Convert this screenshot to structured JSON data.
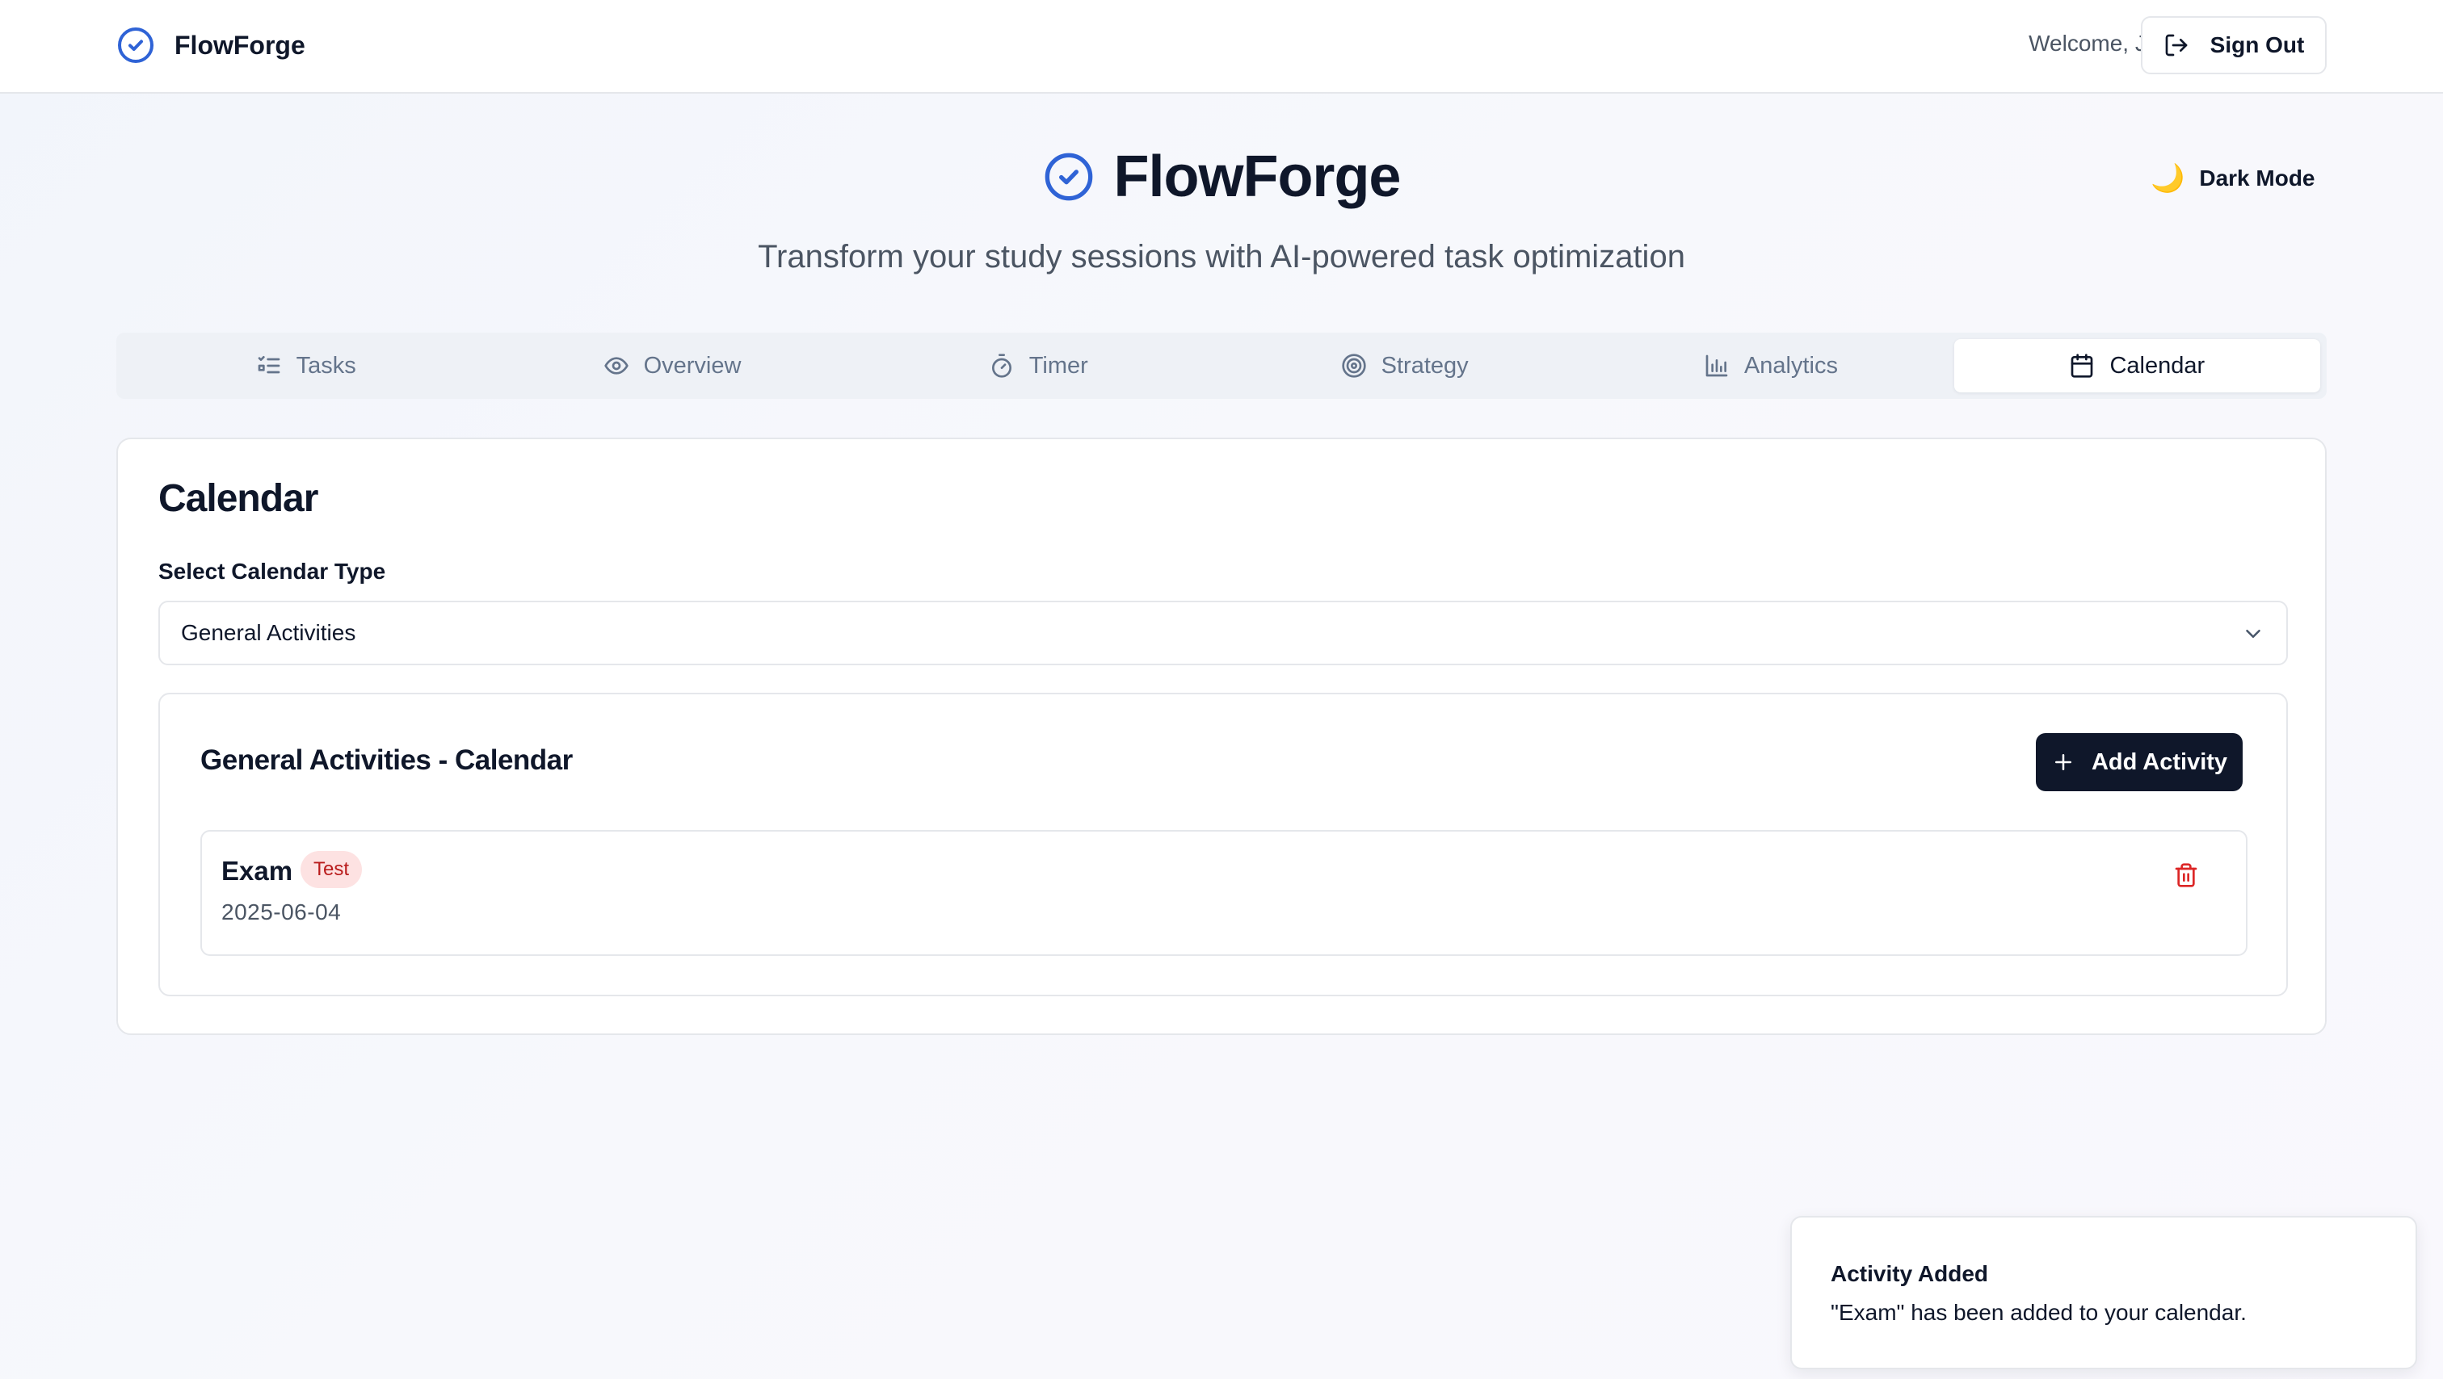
{
  "app": {
    "name": "FlowForge"
  },
  "header": {
    "welcome": "Welcome, Jake",
    "sign_out_label": "Sign Out"
  },
  "hero": {
    "title": "FlowForge",
    "subtitle": "Transform your study sessions with AI-powered task optimization",
    "dark_mode_label": "Dark Mode",
    "dark_mode_icon": "🌙"
  },
  "tabs": [
    {
      "label": "Tasks",
      "icon": "list-checks-icon"
    },
    {
      "label": "Overview",
      "icon": "eye-icon"
    },
    {
      "label": "Timer",
      "icon": "timer-icon"
    },
    {
      "label": "Strategy",
      "icon": "target-icon"
    },
    {
      "label": "Analytics",
      "icon": "bar-chart-icon"
    },
    {
      "label": "Calendar",
      "icon": "calendar-icon",
      "active": true
    }
  ],
  "calendar": {
    "title": "Calendar",
    "select_label": "Select Calendar Type",
    "selected_type": "General Activities",
    "section_title": "General Activities - Calendar",
    "add_button_label": "Add Activity",
    "activities": [
      {
        "name": "Exam",
        "tag": "Test",
        "date": "2025-06-04"
      }
    ]
  },
  "toast": {
    "title": "Activity Added",
    "message": "\"Exam\" has been added to your calendar."
  },
  "colors": {
    "brand_blue": "#2f63d6",
    "primary_dark": "#0f172a",
    "badge_bg": "#fde2e2",
    "badge_text": "#b91c1c",
    "delete_red": "#dc2626"
  }
}
